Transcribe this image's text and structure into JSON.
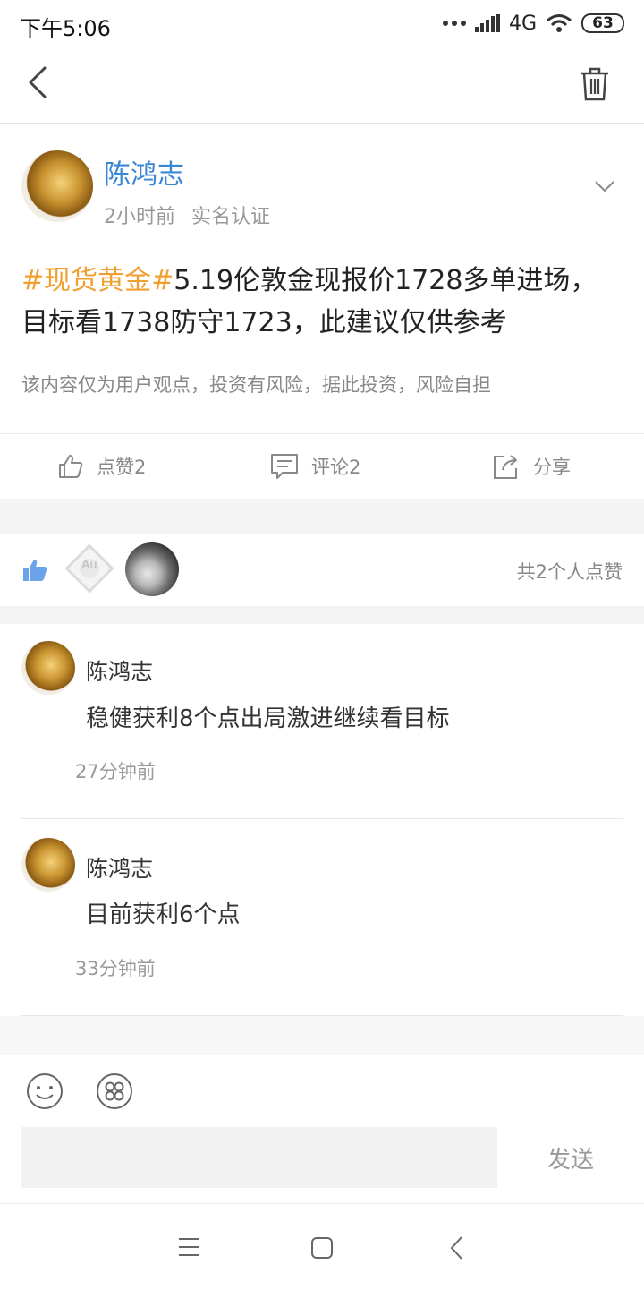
{
  "status_bar": {
    "time": "下午5:06",
    "network": "4G",
    "battery": "63"
  },
  "post": {
    "author": "陈鸿志",
    "time_ago": "2小时前",
    "verified": "实名认证",
    "hashtag": "#现货黄金#",
    "body": "5.19伦敦金现报价1728多单进场，目标看1738防守1723，此建议仅供参考",
    "disclaimer": "该内容仅为用户观点，投资有风险，据此投资，风险自担"
  },
  "actions": {
    "like": "点赞2",
    "comment": "评论2",
    "share": "分享"
  },
  "likes": {
    "summary": "共2个人点赞",
    "avatar_badge": "Au"
  },
  "comments": [
    {
      "name": "陈鸿志",
      "text": "稳健获利8个点出局激进继续看目标",
      "time": "27分钟前"
    },
    {
      "name": "陈鸿志",
      "text": "目前获利6个点",
      "time": "33分钟前"
    }
  ],
  "composer": {
    "placeholder": "",
    "send_label": "发送"
  },
  "icons": {
    "back": "back-arrow-icon",
    "trash": "trash-icon",
    "chevron": "chevron-down-icon",
    "like": "thumbs-up-icon",
    "comment": "comment-icon",
    "share": "share-icon",
    "emoji": "emoji-icon",
    "more": "apps-icon"
  },
  "colors": {
    "accent": "#3a86d6",
    "hashtag": "#f0a030",
    "like_blue": "#6aa3ea"
  }
}
